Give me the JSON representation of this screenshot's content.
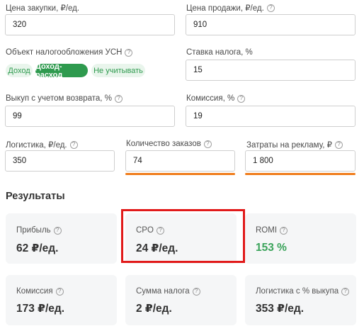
{
  "inputs": {
    "purchase_price": {
      "label": "Цена закупки, ₽/ед.",
      "value": "320"
    },
    "sale_price": {
      "label": "Цена продажи, ₽/ед.",
      "value": "910"
    },
    "tax_object": {
      "label": "Объект налогообложения УСН",
      "options": [
        "Доход",
        "Доход-расход",
        "Не учитывать"
      ],
      "selected": "Доход-расход"
    },
    "tax_rate": {
      "label": "Ставка налога, %",
      "value": "15"
    },
    "buyout": {
      "label": "Выкуп с учетом возврата, %",
      "value": "99"
    },
    "commission": {
      "label": "Комиссия, %",
      "value": "19"
    },
    "logistics": {
      "label": "Логистика, ₽/ед.",
      "value": "350"
    },
    "orders": {
      "label": "Количество заказов",
      "value": "74"
    },
    "ad_spend": {
      "label": "Затраты на рекламу, ₽",
      "value": "1 800"
    }
  },
  "results": {
    "heading": "Результаты",
    "cards": [
      {
        "label": "Прибыль",
        "value": "62 ₽/ед."
      },
      {
        "label": "CPO",
        "value": "24 ₽/ед."
      },
      {
        "label": "ROMI",
        "value": "153 %"
      },
      {
        "label": "Комиссия",
        "value": "173 ₽/ед."
      },
      {
        "label": "Сумма налога",
        "value": "2 ₽/ед."
      },
      {
        "label": "Логистика с % выкупа",
        "value": "353 ₽/ед."
      }
    ]
  },
  "colors": {
    "accent_green": "#2e9a4e",
    "underline_orange": "#f07d1b",
    "highlight_red": "#e11a1a"
  },
  "icons": {
    "help": "question-circle-icon"
  }
}
